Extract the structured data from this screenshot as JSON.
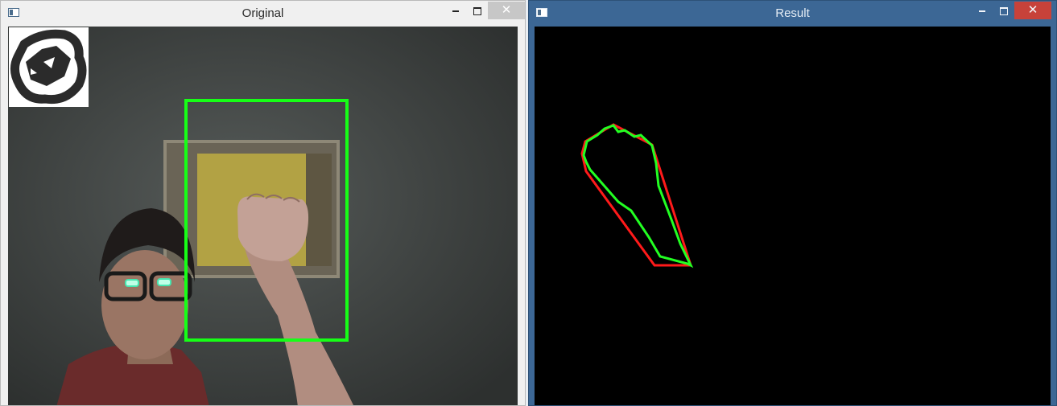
{
  "windows": [
    {
      "title": "Original",
      "content": "webcam feed with green detection rectangle and logo overlay"
    },
    {
      "title": "Result",
      "content": "black canvas with red convex hull and green contour"
    }
  ],
  "colors": {
    "detection_box": "#16ff16",
    "hull": "#ff1a1a",
    "contour": "#22ff22",
    "result_title_bar": "#3c6795",
    "close_button": "#c7423a"
  }
}
